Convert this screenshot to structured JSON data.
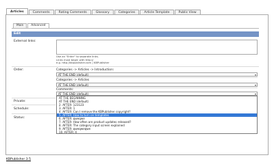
{
  "top_tabs": [
    "Articles",
    "Comments",
    "Rating Comments",
    "Glossary",
    "Categories",
    "Article Template",
    "Public View"
  ],
  "inner_tabs": [
    "Main",
    "Advanced"
  ],
  "edit_header": "Edit",
  "labels": {
    "external_links": "External links:",
    "order": "Order:",
    "private": "Private:",
    "schedule": "Schedule:",
    "status": "Status:"
  },
  "external_links_hint": [
    "Use an \"Enter\" to separate links.",
    "Links must begin with http://",
    "e.g. http://kbpublisher.com | KBPublisher"
  ],
  "order": {
    "group1_label": "Categories -> Articles -> Introduction:",
    "group1_value": "AT THE END (default)",
    "group2_label": "Categories -> Articles",
    "group2_value": "AT THE END (default)",
    "group3_label": "Comments:",
    "group3_value": "AT THE END (default)"
  },
  "dropdown_options": [
    "AT THE BEGINNING",
    "AT THE END (default)",
    "2. AFTER: 123123",
    "3. AFTER: 1",
    "4. AFTER: Can I remove the KBPublisher copyright?",
    "5. AFTER: How to turn on templates",
    "6. AFTER: qweqwe",
    "7. AFTER: How often are product updates released?",
    "8. AFTER: The category input screen explained",
    "9. AFTER: qweqweqwe",
    "10. AFTER: 4"
  ],
  "dropdown_selected_index": 5,
  "footer_link": "KBPublisher 3.5"
}
